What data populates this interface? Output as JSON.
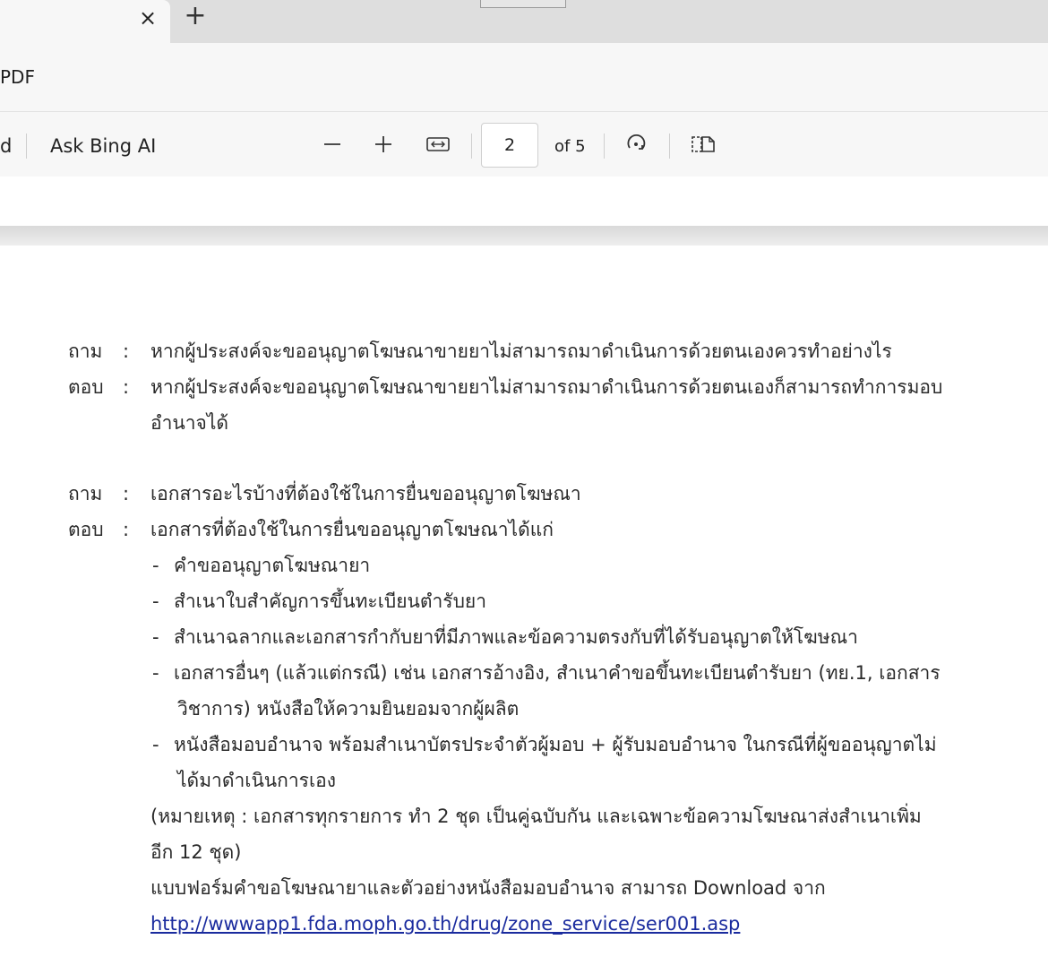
{
  "browser": {
    "tab_close_glyph": "×",
    "new_tab_glyph": "+",
    "address_text": "PDF"
  },
  "pdf_toolbar": {
    "cut_label": "d",
    "ask_bing_label": "Ask Bing AI",
    "zoom_out_icon": "minus-icon",
    "zoom_in_icon": "plus-icon",
    "fit_width_icon": "fit-width-icon",
    "page_current": "2",
    "page_total_label": "of 5",
    "rotate_icon": "rotate-icon",
    "page_view_icon": "page-view-icon"
  },
  "document": {
    "q1": {
      "q_label": "ถาม",
      "question": "หากผู้ประสงค์จะขออนุญาตโฆษณาขายยาไม่สามารถมาดำเนินการด้วยตนเองควรทำอย่างไร",
      "a_label": "ตอบ",
      "answer_line1": "หากผู้ประสงค์จะขออนุญาตโฆษณาขายยาไม่สามารถมาดำเนินการด้วยตนเองก็สามารถทำการมอบ",
      "answer_line2": "อำนาจได้"
    },
    "q2": {
      "q_label": "ถาม",
      "question": "เอกสารอะไรบ้างที่ต้องใช้ในการยื่นขออนุญาตโฆษณา",
      "a_label": "ตอบ",
      "answer_intro": "เอกสารที่ต้องใช้ในการยื่นขออนุญาตโฆษณาได้แก่",
      "items": [
        "คำขออนุญาตโฆษณายา",
        "สำเนาใบสำคัญการขึ้นทะเบียนตำรับยา",
        "สำเนาฉลากและเอกสารกำกับยาที่มีภาพและข้อความตรงกับที่ได้รับอนุญาตให้โฆษณา",
        "เอกสารอื่นๆ (แล้วแต่กรณี) เช่น เอกสารอ้างอิง, สำเนาคำขอขึ้นทะเบียนตำรับยา (ทย.1, เอกสาร",
        "วิชาการ) หนังสือให้ความยินยอมจากผู้ผลิต",
        "หนังสือมอบอำนาจ พร้อมสำเนาบัตรประจำตัวผู้มอบ + ผู้รับมอบอำนาจ ในกรณีที่ผู้ขออนุญาตไม่",
        "ได้มาดำเนินการเอง"
      ],
      "note_line1": "(หมายเหตุ : เอกสารทุกรายการ ทำ 2 ชุด เป็นคู่ฉบับกัน และเฉพาะข้อความโฆษณาส่งสำเนาเพิ่ม",
      "note_line2": "อีก 12 ชุด)",
      "download_text": "แบบฟอร์มคำขอโฆษณายาและตัวอย่างหนังสือมอบอำนาจ สามารถ Download จาก",
      "download_link": "http://wwwapp1.fda.moph.go.th/drug/zone_service/ser001.asp"
    }
  }
}
